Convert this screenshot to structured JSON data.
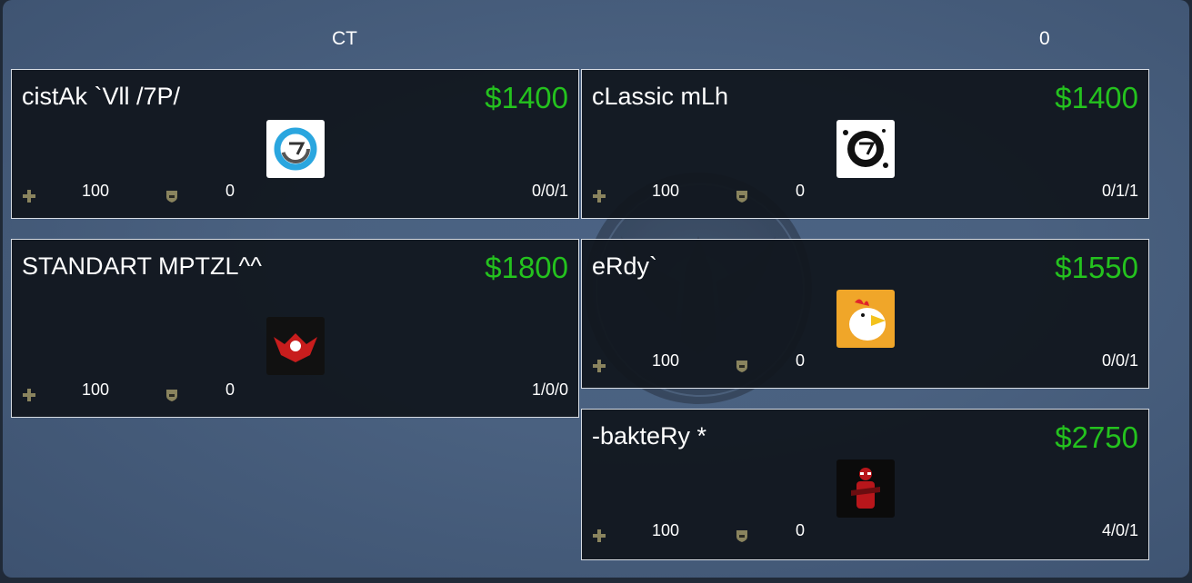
{
  "header": {
    "team": "CT",
    "score": "0"
  },
  "colors": {
    "money": "#24c21e",
    "panel": "#4a6180",
    "card": "#11161e"
  },
  "players": [
    {
      "name": "cistAk `Vll /7P/",
      "money": "$1400",
      "hp": "100",
      "armor": "0",
      "kda": "0/0/1",
      "avatar": "ring-logo-icon"
    },
    {
      "name": "cLassic mLh",
      "money": "$1400",
      "hp": "100",
      "armor": "0",
      "kda": "0/1/1",
      "avatar": "splatter-logo-icon"
    },
    {
      "name": "STANDART MPTZL^^",
      "money": "$1800",
      "hp": "100",
      "armor": "0",
      "kda": "1/0/0",
      "avatar": "red-eagle-icon"
    },
    {
      "name": "eRdy`",
      "money": "$1550",
      "hp": "100",
      "armor": "0",
      "kda": "0/0/1",
      "avatar": "chicken-icon"
    },
    {
      "name": "-bakteRy *",
      "money": "$2750",
      "hp": "100",
      "armor": "0",
      "kda": "4/0/1",
      "avatar": "deadpool-icon"
    }
  ]
}
